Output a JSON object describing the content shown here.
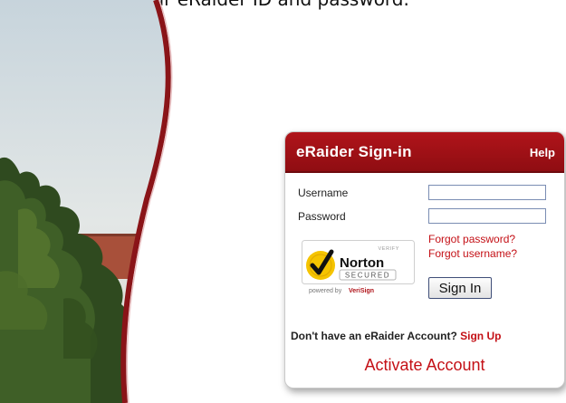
{
  "intro_text": "account using your eRaider ID and password.",
  "signin": {
    "title": "eRaider Sign-in",
    "help_label": "Help",
    "username_label": "Username",
    "password_label": "Password",
    "username_value": "",
    "password_value": "",
    "forgot_password": "Forgot password?",
    "forgot_username": "Forgot username?",
    "sign_in_button": "Sign In",
    "no_account_text": "Don't have an eRaider Account?",
    "sign_up_link": "Sign Up",
    "activate_link": "Activate Account"
  },
  "norton_badge": {
    "verify": "VERIFY",
    "brand": "Norton",
    "secured": "SECURED",
    "powered_by": "powered by",
    "verisign": "VeriSign"
  },
  "colors": {
    "accent_red": "#a3121a",
    "link_red": "#c41016"
  }
}
